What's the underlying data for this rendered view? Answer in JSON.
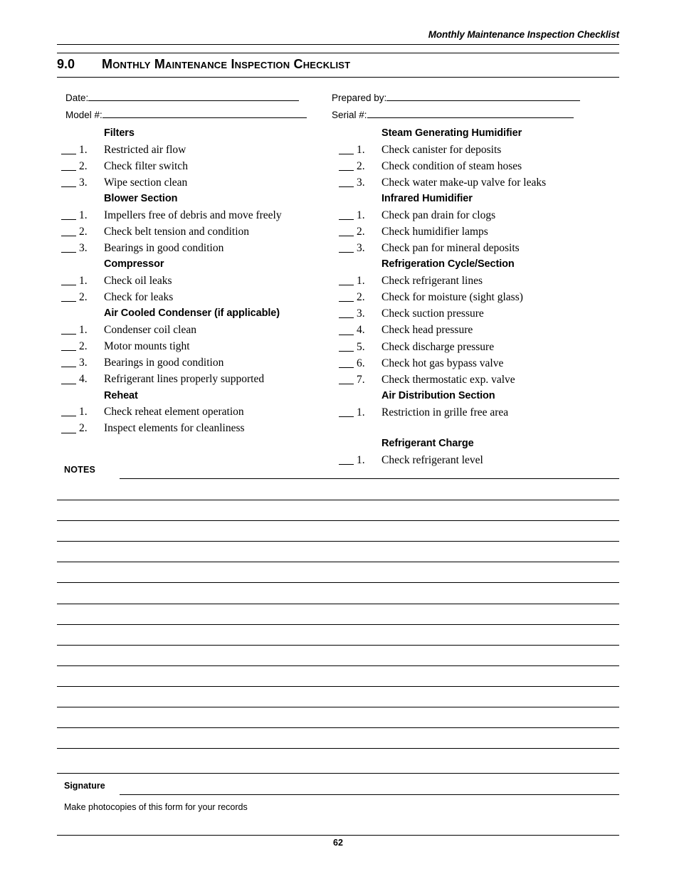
{
  "running_header": "Monthly Maintenance Inspection Checklist",
  "section": {
    "number": "9.0",
    "title": "Monthly Maintenance Inspection Checklist"
  },
  "fields": {
    "date": {
      "label": "Date:",
      "value": ""
    },
    "model": {
      "label": "Model #:",
      "value": ""
    },
    "prepared_by": {
      "label": "Prepared by:",
      "value": ""
    },
    "serial": {
      "label": "Serial #:",
      "value": ""
    }
  },
  "columns": {
    "left": [
      {
        "heading": "Filters",
        "spaced": false,
        "items": [
          {
            "num": "1.",
            "text": "Restricted air flow"
          },
          {
            "num": "2.",
            "text": "Check filter switch"
          },
          {
            "num": "3.",
            "text": "Wipe section clean"
          }
        ]
      },
      {
        "heading": "Blower Section",
        "spaced": false,
        "items": [
          {
            "num": "1.",
            "text": "Impellers free of debris and move freely"
          },
          {
            "num": "2.",
            "text": "Check belt tension and condition"
          },
          {
            "num": "3.",
            "text": "Bearings in good condition"
          }
        ]
      },
      {
        "heading": "Compressor",
        "spaced": false,
        "items": [
          {
            "num": "1.",
            "text": "Check oil leaks"
          },
          {
            "num": "2.",
            "text": "Check for leaks"
          }
        ]
      },
      {
        "heading": "Air Cooled Condenser (if applicable)",
        "spaced": false,
        "items": [
          {
            "num": "1.",
            "text": "Condenser coil clean"
          },
          {
            "num": "2.",
            "text": "Motor mounts tight"
          },
          {
            "num": "3.",
            "text": "Bearings in good condition"
          },
          {
            "num": "4.",
            "text": "Refrigerant lines properly supported"
          }
        ]
      },
      {
        "heading": "Reheat",
        "spaced": false,
        "items": [
          {
            "num": "1.",
            "text": "Check reheat element operation"
          },
          {
            "num": "2.",
            "text": "Inspect elements for cleanliness"
          }
        ]
      }
    ],
    "right": [
      {
        "heading": "Steam Generating Humidifier",
        "spaced": false,
        "items": [
          {
            "num": "1.",
            "text": "Check canister for deposits"
          },
          {
            "num": "2.",
            "text": "Check condition of steam hoses"
          },
          {
            "num": "3.",
            "text": "Check water make-up valve for leaks"
          }
        ]
      },
      {
        "heading": "Infrared Humidifier",
        "spaced": false,
        "items": [
          {
            "num": "1.",
            "text": "Check pan drain for clogs"
          },
          {
            "num": "2.",
            "text": "Check humidifier lamps"
          },
          {
            "num": "3.",
            "text": "Check pan for mineral deposits"
          }
        ]
      },
      {
        "heading": "Refrigeration Cycle/Section",
        "spaced": false,
        "items": [
          {
            "num": "1.",
            "text": "Check refrigerant lines"
          },
          {
            "num": "2.",
            "text": "Check for moisture (sight glass)"
          },
          {
            "num": "3.",
            "text": "Check suction pressure"
          },
          {
            "num": "4.",
            "text": "Check head pressure"
          },
          {
            "num": "5.",
            "text": "Check discharge pressure"
          },
          {
            "num": "6.",
            "text": "Check hot gas bypass valve"
          },
          {
            "num": "7.",
            "text": "Check thermostatic exp. valve"
          }
        ]
      },
      {
        "heading": "Air Distribution Section",
        "spaced": false,
        "items": [
          {
            "num": "1.",
            "text": "Restriction in grille free area"
          }
        ]
      },
      {
        "heading": "Refrigerant Charge",
        "spaced": true,
        "items": [
          {
            "num": "1.",
            "text": "Check refrigerant level"
          }
        ]
      }
    ]
  },
  "notes": {
    "label": "NOTES",
    "line_count": 13
  },
  "signature": {
    "label": "Signature",
    "photocopy_note": "Make photocopies of this form for your records"
  },
  "footer": {
    "page_number": "62"
  }
}
